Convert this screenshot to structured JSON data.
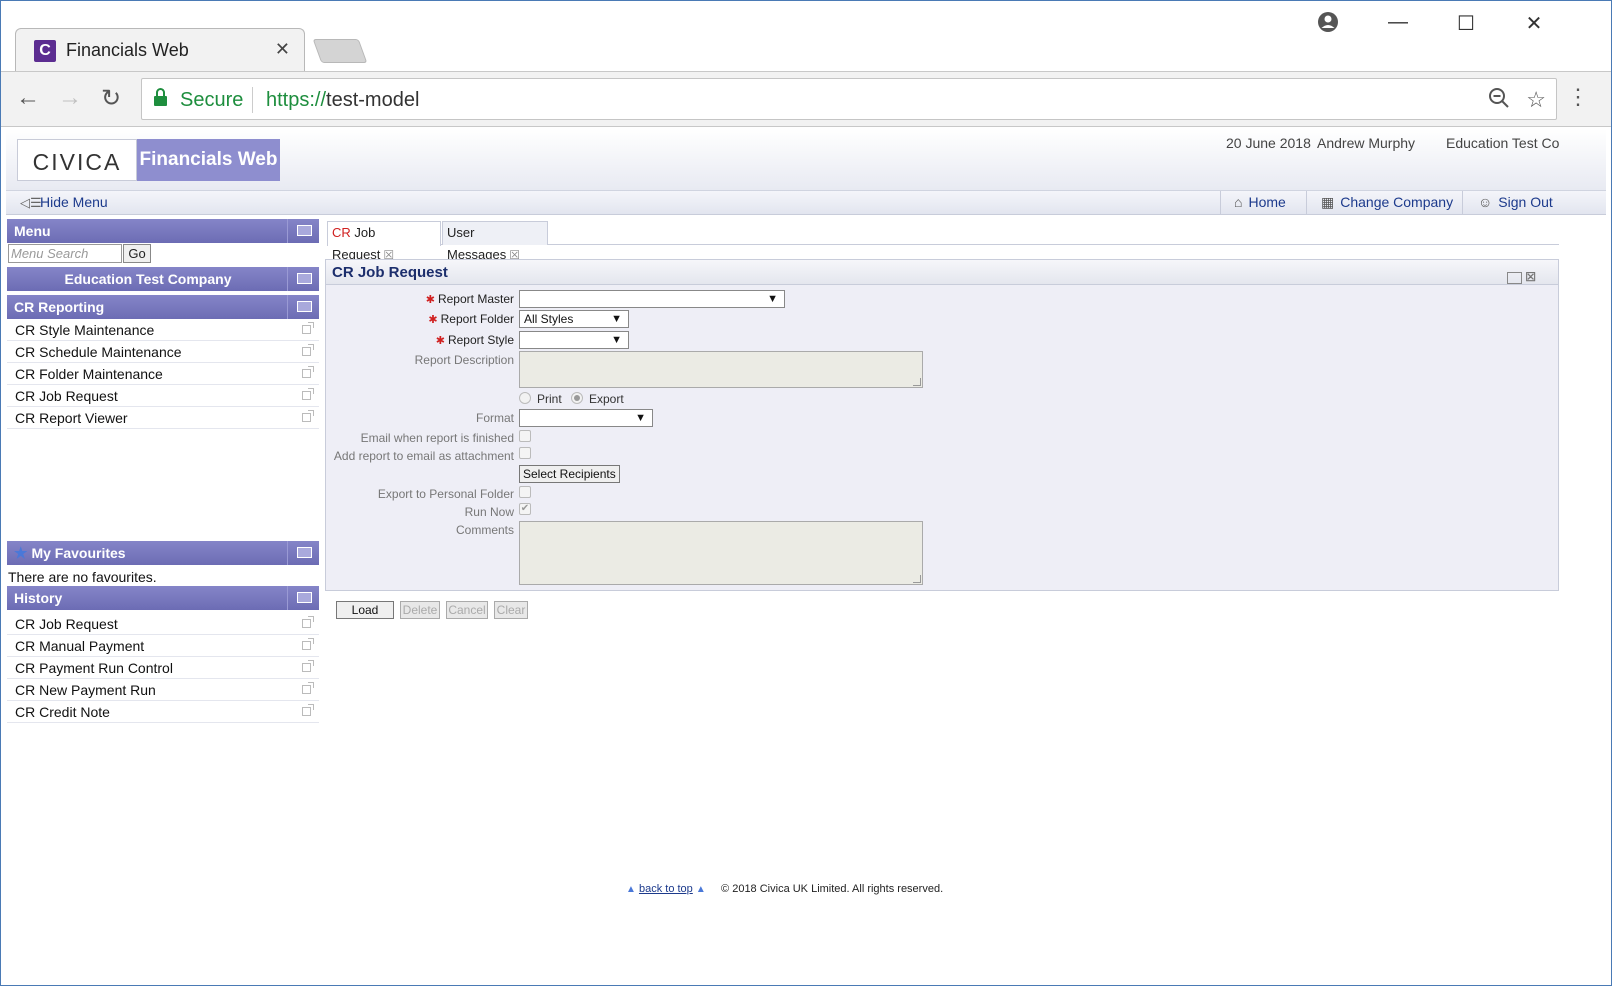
{
  "browser": {
    "tab_title": "Financials Web",
    "favicon_letter": "C",
    "secure_label": "Secure",
    "url_scheme": "https://",
    "url_host": "test-model"
  },
  "header": {
    "logo_text": "CIVICA",
    "brand": "Financials Web",
    "date": "20 June 2018",
    "user": "Andrew Murphy",
    "company": "Education Test Co"
  },
  "subbar": {
    "hide_menu": "Hide Menu",
    "home": "Home",
    "change_company": "Change Company",
    "sign_out": "Sign Out"
  },
  "sidebar": {
    "menu_title": "Menu",
    "search_placeholder": "Menu Search",
    "go_label": "Go",
    "company_title": "Education Test Company",
    "section_title": "CR Reporting",
    "items": [
      {
        "label": "CR Style Maintenance"
      },
      {
        "label": "CR Schedule Maintenance"
      },
      {
        "label": "CR Folder Maintenance"
      },
      {
        "label": "CR Job Request"
      },
      {
        "label": "CR Report Viewer"
      }
    ],
    "favourites_title": "My Favourites",
    "favourites_empty": "There are no favourites.",
    "history_title": "History",
    "history_items": [
      {
        "label": "CR Job Request"
      },
      {
        "label": "CR Manual Payment"
      },
      {
        "label": "CR Payment Run Control"
      },
      {
        "label": "CR New Payment Run"
      },
      {
        "label": "CR Credit Note"
      }
    ]
  },
  "content_tabs": [
    {
      "prefix": "CR",
      "label": " Job Request"
    },
    {
      "label": "User Messages"
    }
  ],
  "form": {
    "title": "CR Job Request",
    "report_master_label": "Report Master",
    "report_master_value": "",
    "report_folder_label": "Report Folder",
    "report_folder_value": "All Styles",
    "report_style_label": "Report Style",
    "report_style_value": "",
    "report_description_label": "Report Description",
    "print_label": "Print",
    "export_label": "Export",
    "selected_output": "Export",
    "format_label": "Format",
    "format_value": "",
    "email_finished_label": "Email when report is finished",
    "attach_label": "Add report to email as attachment",
    "select_recipients_label": "Select Recipients",
    "export_personal_label": "Export to Personal Folder",
    "run_now_label": "Run Now",
    "run_now_checked": true,
    "comments_label": "Comments"
  },
  "actions": {
    "load": "Load",
    "delete": "Delete",
    "cancel": "Cancel",
    "clear": "Clear"
  },
  "footer": {
    "back_to_top": "back to top",
    "copyright": "© 2018 Civica UK Limited. All rights reserved."
  },
  "colors": {
    "panel_header": "#6c6cb4",
    "brand_box": "#8e8ecf",
    "secure_green": "#1e8e3e",
    "required_star": "#d02020"
  }
}
